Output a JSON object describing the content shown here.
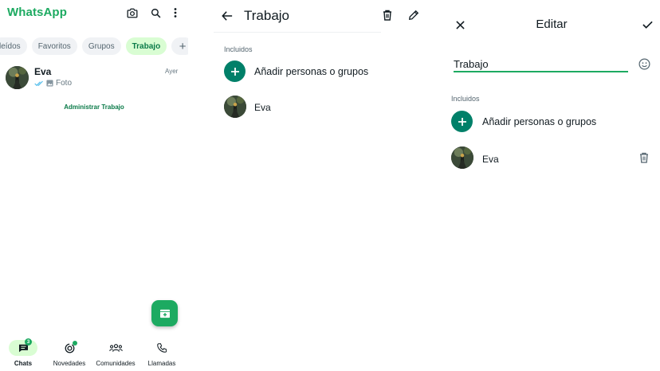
{
  "panel1": {
    "app_title": "WhatsApp",
    "header_icons": [
      "camera-icon",
      "search-icon",
      "more-vertical-icon"
    ],
    "filter_chips": [
      {
        "label": "leídos",
        "active": false
      },
      {
        "label": "Favoritos",
        "active": false
      },
      {
        "label": "Grupos",
        "active": false
      },
      {
        "label": "Trabajo",
        "active": true
      },
      {
        "label": "+",
        "active": false
      }
    ],
    "chat": {
      "name": "Eva",
      "time": "Ayer",
      "preview": "Foto",
      "status_icon": "double-check-icon",
      "media_icon": "image-icon"
    },
    "manage_link": "Administrar Trabajo",
    "fab_icon": "new-chat-icon",
    "nav": [
      {
        "label": "Chats",
        "icon": "chats-icon",
        "badge": "3",
        "active": true
      },
      {
        "label": "Novedades",
        "icon": "updates-icon",
        "dot": true,
        "active": false
      },
      {
        "label": "Comunidades",
        "icon": "communities-icon",
        "active": false
      },
      {
        "label": "Llamadas",
        "icon": "calls-icon",
        "active": false
      }
    ]
  },
  "panel2": {
    "title": "Trabajo",
    "section_label": "Incluidos",
    "add_label": "Añadir personas o grupos",
    "member_name": "Eva",
    "icons": [
      "back-arrow-icon",
      "delete-icon",
      "edit-pencil-icon"
    ]
  },
  "panel3": {
    "title": "Editar",
    "name_value": "Trabajo",
    "section_label": "Incluidos",
    "add_label": "Añadir personas o grupos",
    "member_name": "Eva",
    "icons": [
      "close-icon",
      "confirm-check-icon",
      "emoji-icon",
      "delete-icon"
    ]
  },
  "colors": {
    "whatsapp_green": "#1daa61",
    "dark_green": "#008069",
    "chip_active_bg": "#d9fdd3",
    "chip_bg": "#f0f2f5",
    "text_primary": "#111b21",
    "text_secondary": "#667781",
    "read_check": "#53bdeb"
  }
}
